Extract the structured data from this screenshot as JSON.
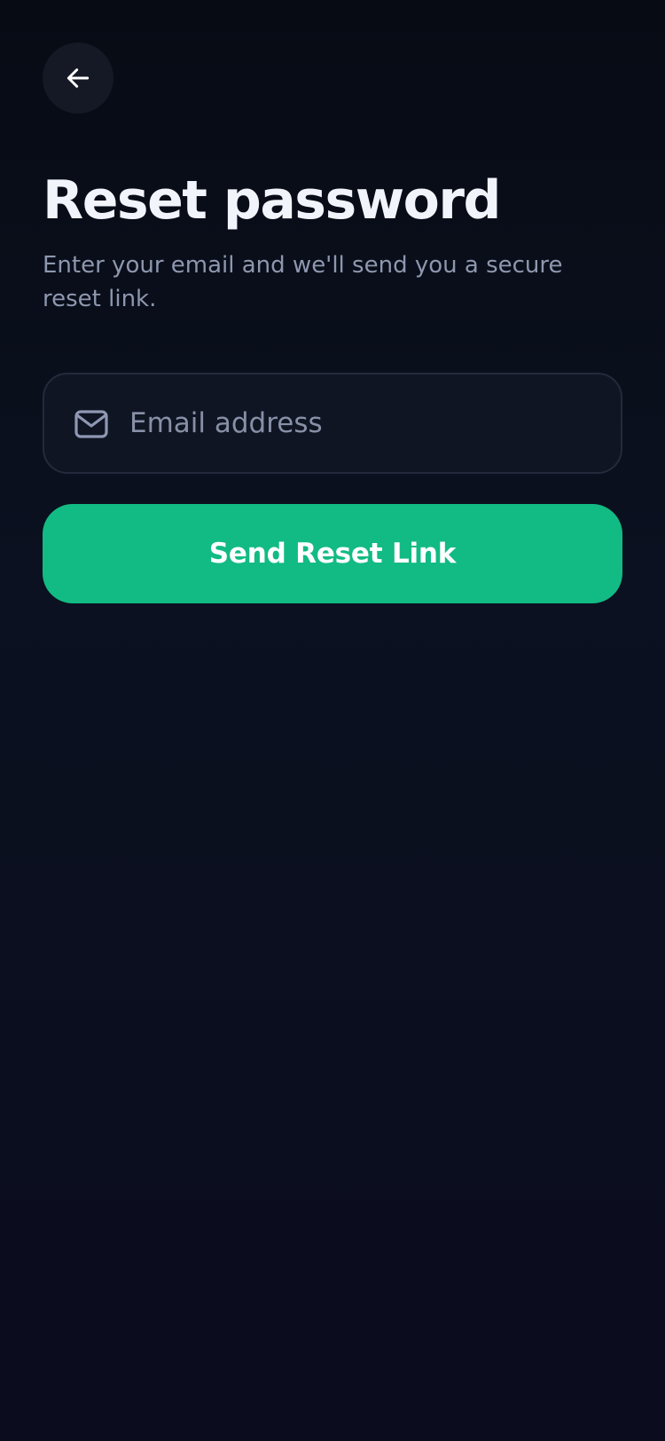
{
  "header": {
    "back_icon": "arrow-left-icon",
    "back_label": "Back"
  },
  "main": {
    "title": "Reset password",
    "subtitle": "Enter your email and we'll send you a secure reset link."
  },
  "form": {
    "email_icon": "mail-icon",
    "email_placeholder": "Email address",
    "email_value": ""
  },
  "actions": {
    "submit_label": "Send Reset Link"
  },
  "colors": {
    "background": "#0b1120",
    "accent": "#12bb83",
    "field_background": "#0f1523",
    "field_border": "#232a3b",
    "muted_text": "#8e97ae"
  }
}
